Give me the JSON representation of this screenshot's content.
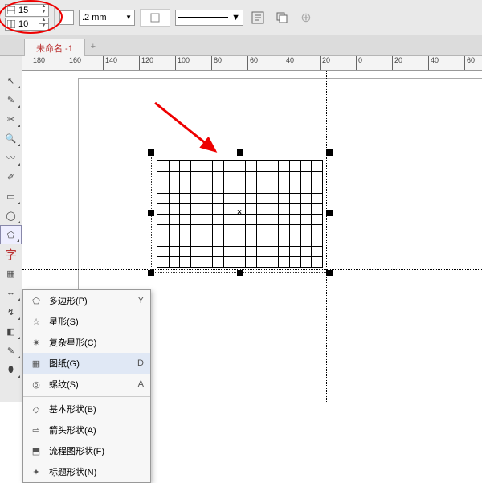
{
  "topbar": {
    "rows": "15",
    "cols": "10",
    "stroke_width": ".2 mm",
    "line_pattern_label": ""
  },
  "tab": {
    "title": "未命名 -1"
  },
  "ruler": {
    "ticks": [
      "180",
      "160",
      "140",
      "120",
      "100",
      "80",
      "60",
      "40",
      "20",
      "0",
      "20",
      "40",
      "60"
    ]
  },
  "selection": {
    "grid_cols": 15,
    "grid_rows": 10
  },
  "flyout": {
    "items": [
      {
        "icon": "⬠",
        "label": "多边形(P)",
        "shortcut": "Y"
      },
      {
        "icon": "☆",
        "label": "星形(S)",
        "shortcut": ""
      },
      {
        "icon": "✷",
        "label": "复杂星形(C)",
        "shortcut": ""
      },
      {
        "icon": "▦",
        "label": "图纸(G)",
        "shortcut": "D"
      },
      {
        "icon": "◎",
        "label": "螺纹(S)",
        "shortcut": "A"
      }
    ],
    "items2": [
      {
        "icon": "◇",
        "label": "基本形状(B)",
        "shortcut": ""
      },
      {
        "icon": "⇨",
        "label": "箭头形状(A)",
        "shortcut": ""
      },
      {
        "icon": "⬒",
        "label": "流程图形状(F)",
        "shortcut": ""
      },
      {
        "icon": "✦",
        "label": "标题形状(N)",
        "shortcut": ""
      }
    ]
  }
}
